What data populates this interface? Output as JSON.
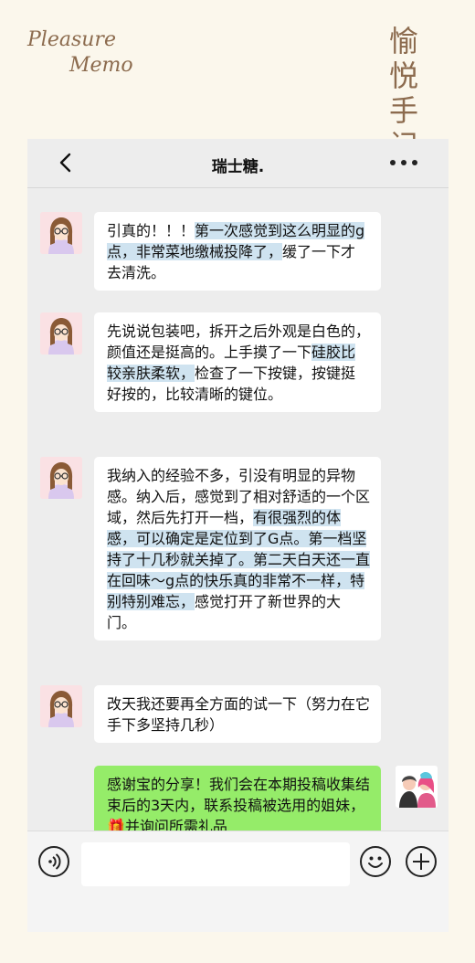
{
  "brand": {
    "en_line1": "Pleasure",
    "en_line2": "Memo",
    "cn_line1": "愉悦",
    "cn_line2": "手记"
  },
  "chat": {
    "title": "瑞士糖.",
    "messages": [
      {
        "from": "user",
        "parts": [
          {
            "text": "引真的！！！",
            "hl": false
          },
          {
            "text": "第一次感觉到这么明显的g点，非常菜地缴械投降了，",
            "hl": true
          },
          {
            "text": "缓了一下才去清洗。",
            "hl": false
          }
        ]
      },
      {
        "from": "user",
        "parts": [
          {
            "text": "先说说包装吧，拆开之后外观是白色的，颜值还是挺高的。上手摸了一下",
            "hl": false
          },
          {
            "text": "硅胶比较亲肤柔软，",
            "hl": true
          },
          {
            "text": "检查了一下按键，按键挺好按的，比较清晰的键位。",
            "hl": false
          }
        ]
      },
      {
        "from": "user",
        "parts": [
          {
            "text": "我纳入的经验不多，引没有明显的异物感。纳入后，感觉到了相对舒适的一个区域，然后先打开一档，",
            "hl": false
          },
          {
            "text": "有很强烈的体感，可以确定是定位到了G点。第一档坚持了十几秒就关掉了。第二天白天还一直在回味～g点的快乐真的非常不一样，特别特别难忘，",
            "hl": true
          },
          {
            "text": "感觉打开了新世界的大门。",
            "hl": false
          }
        ]
      },
      {
        "from": "user",
        "parts": [
          {
            "text": "改天我还要再全方面的试一下（努力在它手下多坚持几秒）",
            "hl": false
          }
        ]
      },
      {
        "from": "me",
        "parts": [
          {
            "text": "感谢宝的分享！我们会在本期投稿收集结束后的3天内，联系投稿被选用的姐妹，🎁并询问所需礼品",
            "hl": false
          }
        ]
      }
    ]
  }
}
